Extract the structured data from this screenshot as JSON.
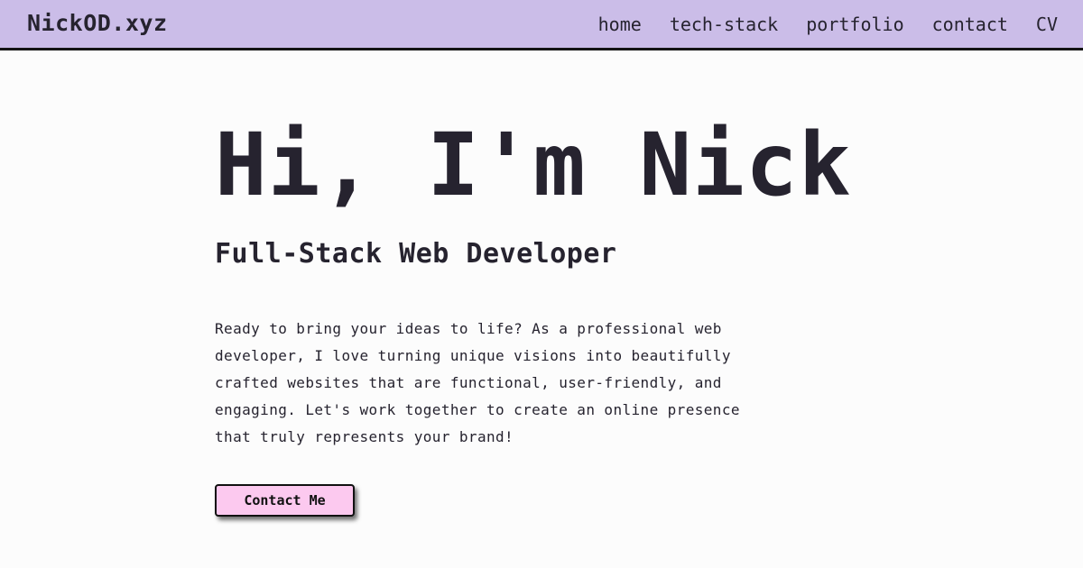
{
  "navbar": {
    "brand": "NickOD.xyz",
    "links": [
      "home",
      "tech-stack",
      "portfolio",
      "contact",
      "CV"
    ]
  },
  "hero": {
    "title": "Hi, I'm Nick",
    "subtitle": "Full-Stack Web Developer",
    "description": "Ready to bring your ideas to life? As a professional web developer, I love turning unique visions into beautifully crafted websites that are functional, user-friendly, and engaging. Let's work together to create an online presence that truly represents your brand!",
    "button_label": "Contact Me"
  },
  "colors": {
    "navbar_bg": "#cbbde8",
    "page_bg": "#fcfcfc",
    "text": "#26232f",
    "button_bg": "#fcc9ef"
  }
}
